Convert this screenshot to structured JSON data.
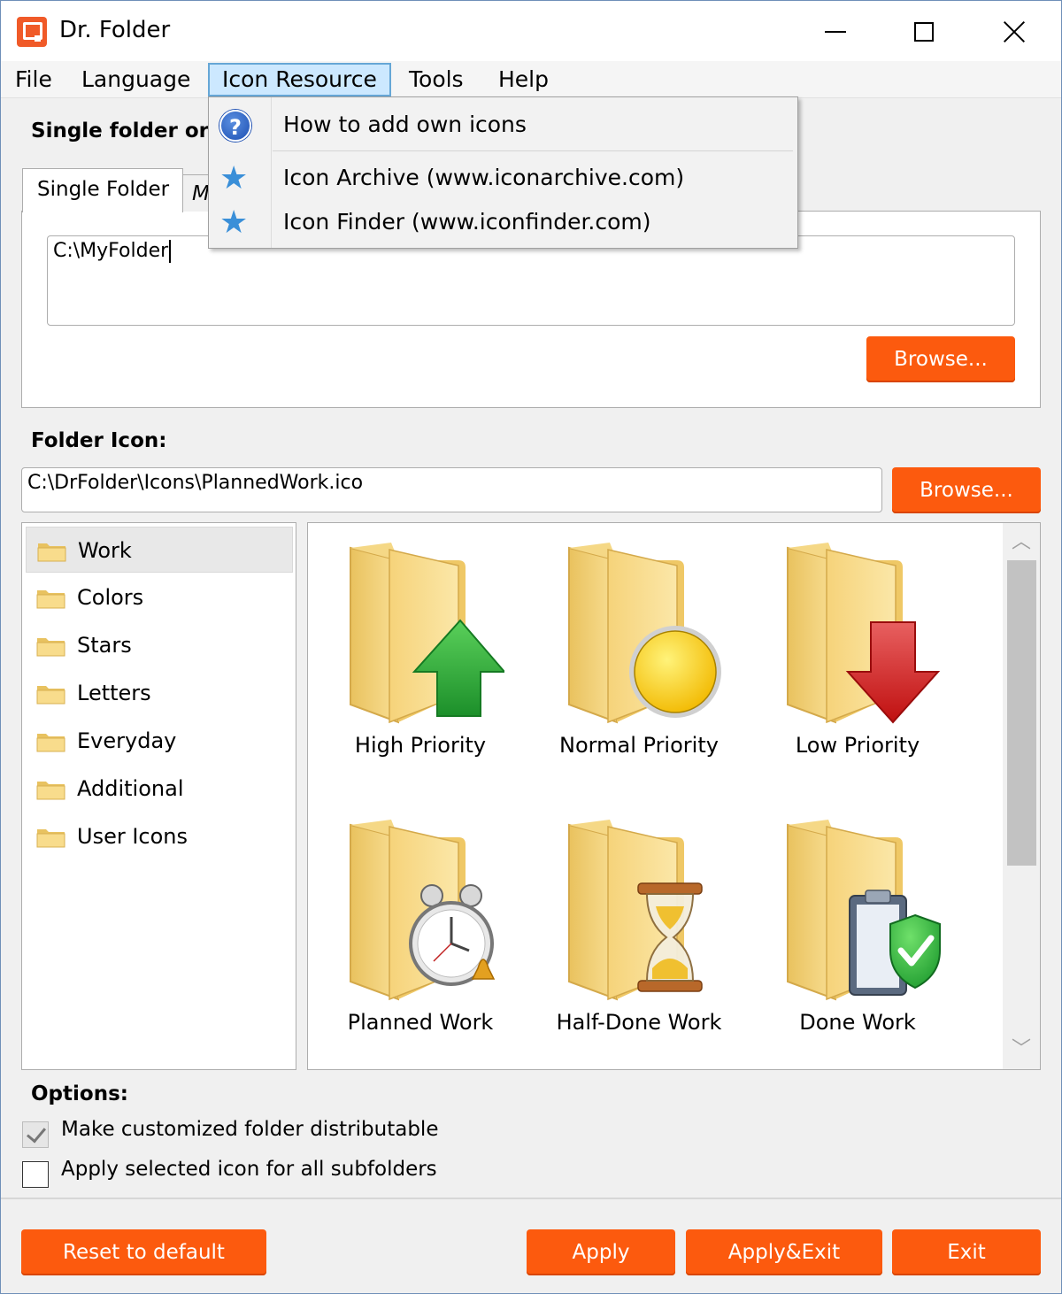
{
  "window": {
    "title": "Dr. Folder",
    "icon": "app-logo-icon"
  },
  "menubar": {
    "items": [
      {
        "label": "File"
      },
      {
        "label": "Language"
      },
      {
        "label": "Icon Resource"
      },
      {
        "label": "Tools"
      },
      {
        "label": "Help"
      }
    ]
  },
  "dropdown": {
    "items": [
      {
        "label": "How to add own icons",
        "icon": "help-icon"
      },
      {
        "label": "Icon Archive (www.iconarchive.com)",
        "icon": "star-icon"
      },
      {
        "label": "Icon Finder (www.iconfinder.com)",
        "icon": "star-icon"
      }
    ]
  },
  "target": {
    "section_label": "Single folder or m",
    "tabs": [
      {
        "label": "Single Folder"
      },
      {
        "label": "M"
      }
    ],
    "path_value": "C:\\MyFolder",
    "browse_label": "Browse..."
  },
  "folder_icon": {
    "section_label": "Folder Icon:",
    "path_value": "C:\\DrFolder\\Icons\\PlannedWork.ico",
    "browse_label": "Browse..."
  },
  "tree": {
    "items": [
      {
        "label": "Work",
        "selected": true
      },
      {
        "label": "Colors"
      },
      {
        "label": "Stars"
      },
      {
        "label": "Letters"
      },
      {
        "label": "Everyday"
      },
      {
        "label": "Additional"
      },
      {
        "label": "User Icons"
      }
    ]
  },
  "icons": {
    "items": [
      {
        "label": "High Priority",
        "icon": "folder-up-arrow-icon"
      },
      {
        "label": "Normal Priority",
        "icon": "folder-yellow-circle-icon"
      },
      {
        "label": "Low Priority",
        "icon": "folder-down-arrow-icon"
      },
      {
        "label": "Planned Work",
        "icon": "folder-alarm-clock-icon"
      },
      {
        "label": "Half-Done Work",
        "icon": "folder-hourglass-icon"
      },
      {
        "label": "Done Work",
        "icon": "folder-clipboard-check-icon"
      }
    ]
  },
  "options": {
    "section_label": "Options:",
    "items": [
      {
        "label": "Make customized folder distributable",
        "checked": true
      },
      {
        "label": "Apply selected icon for all subfolders",
        "checked": false
      }
    ]
  },
  "footer": {
    "reset_label": "Reset to default",
    "apply_label": "Apply",
    "apply_exit_label": "Apply&Exit",
    "exit_label": "Exit"
  },
  "colors": {
    "accent": "#fc5a0e",
    "menu_highlight": "#cce8ff",
    "folder": "#f7d57a"
  }
}
